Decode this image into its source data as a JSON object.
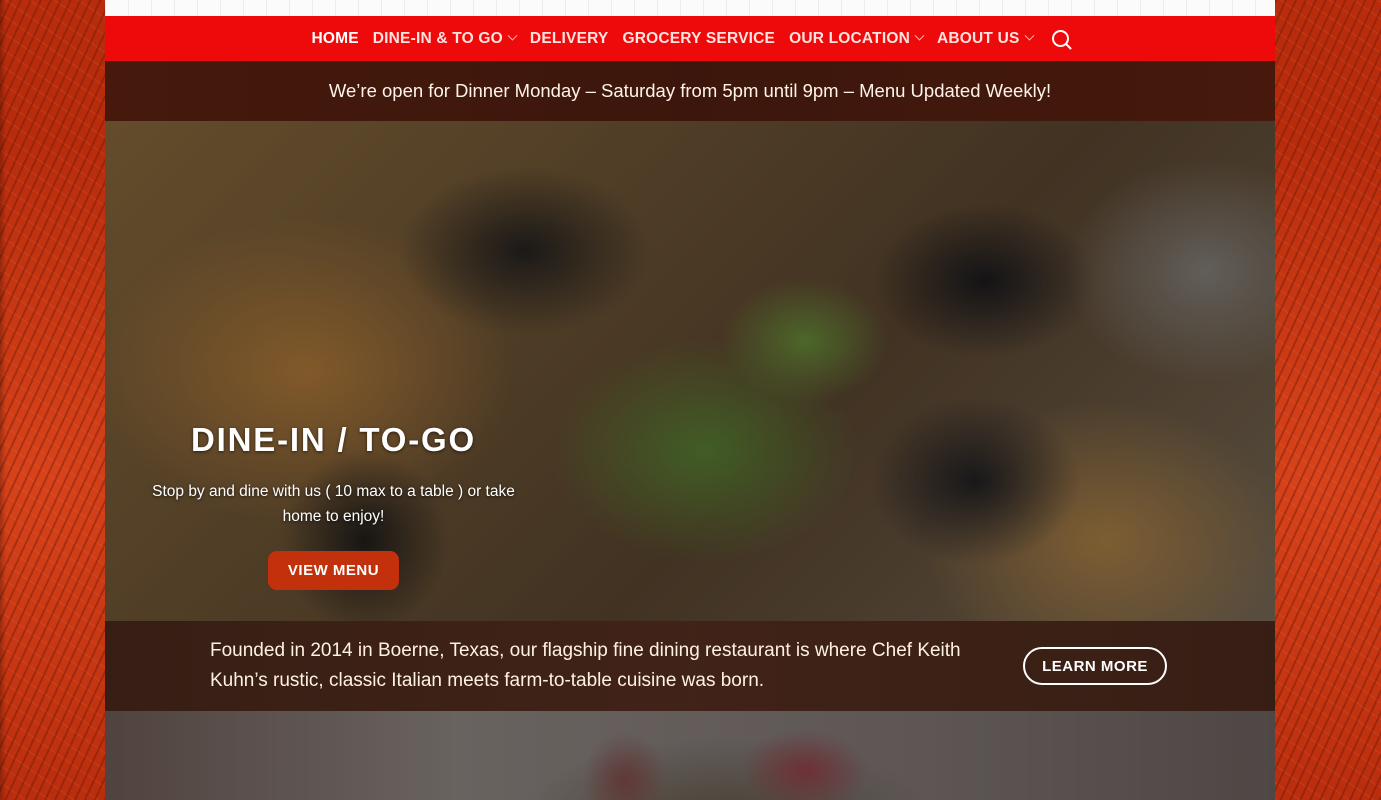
{
  "nav": {
    "items": [
      {
        "label": "HOME",
        "active": true,
        "dropdown": false
      },
      {
        "label": "DINE-IN & TO GO",
        "active": false,
        "dropdown": true
      },
      {
        "label": "DELIVERY",
        "active": false,
        "dropdown": false
      },
      {
        "label": "GROCERY SERVICE",
        "active": false,
        "dropdown": false
      },
      {
        "label": "OUR LOCATION",
        "active": false,
        "dropdown": true
      },
      {
        "label": "ABOUT US",
        "active": false,
        "dropdown": true
      }
    ],
    "search_icon": "search-icon"
  },
  "announcement": "We’re open for Dinner Monday – Saturday from 5pm until 9pm – Menu Updated Weekly!",
  "hero": {
    "title": "DINE-IN / TO-GO",
    "description": "Stop by and dine with us ( 10 max to a table ) or take home to enjoy!",
    "button": "VIEW MENU"
  },
  "about": {
    "text": "Founded in 2014 in Boerne, Texas, our flagship fine dining restaurant is where Chef Keith Kuhn’s rustic, classic Italian meets farm-to-table cuisine was born.",
    "button": "LEARN MORE"
  },
  "colors": {
    "nav_bg": "#ee0a0a",
    "button_bg": "#c2310b",
    "side_bg": "#c9340f"
  }
}
